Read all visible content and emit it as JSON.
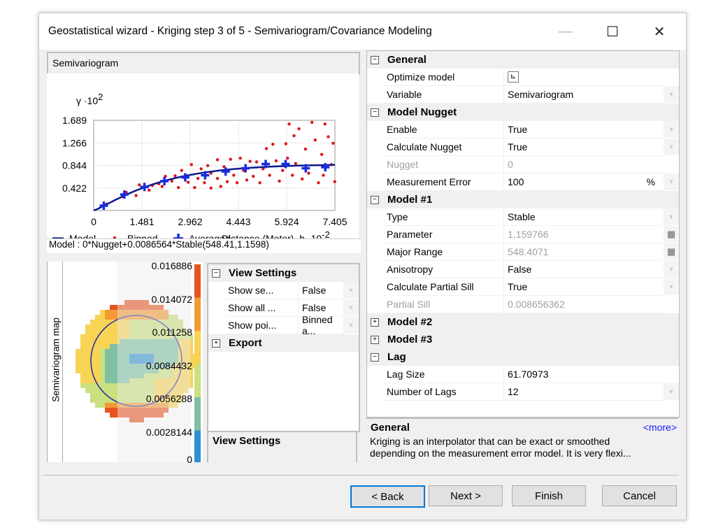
{
  "window": {
    "title": "Geostatistical wizard - Kriging step 3 of 5 - Semivariogram/Covariance Modeling",
    "minimize": "—",
    "maximize": "☐",
    "close": "✕"
  },
  "semivariogram": {
    "panel_title": "Semivariogram",
    "model_text": "Model : 0*Nugget+0.0086564*Stable(548.41,1.1598)",
    "legend": {
      "model": "Model",
      "binned": "Binned",
      "averaged": "Averaged"
    },
    "colors": {
      "model": "#0a1a8c",
      "binned": "#e0141e",
      "averaged": "#1a2be0"
    },
    "chart_data": {
      "type": "scatter",
      "ylabel": "γ ·10",
      "ylabel_exp": "2",
      "xlabel": "Distance (Meter), h ·10",
      "xlabel_exp": "-2",
      "x_ticks": [
        "0",
        "1.481",
        "2.962",
        "4.443",
        "5.924",
        "7.405"
      ],
      "y_ticks": [
        "0.422",
        "0.844",
        "1.266",
        "1.689"
      ],
      "xlim": [
        0,
        7.405
      ],
      "ylim": [
        0,
        1.689
      ],
      "grid": true,
      "legend_placement": "bottom",
      "model": {
        "type": "Stable",
        "nugget": 0,
        "partial_sill": 0.86564,
        "range": 5.4841,
        "parameter": 1.1598
      },
      "averaged": [
        [
          0.31,
          0.09
        ],
        [
          0.94,
          0.3
        ],
        [
          1.56,
          0.44
        ],
        [
          2.17,
          0.55
        ],
        [
          2.81,
          0.62
        ],
        [
          3.42,
          0.66
        ],
        [
          4.05,
          0.73
        ],
        [
          4.66,
          0.79
        ],
        [
          5.28,
          0.87
        ],
        [
          5.89,
          0.87
        ],
        [
          6.51,
          0.79
        ],
        [
          7.11,
          0.81
        ]
      ],
      "binned": [
        [
          0.4,
          0.12
        ],
        [
          0.9,
          0.26
        ],
        [
          1.0,
          0.34
        ],
        [
          1.3,
          0.28
        ],
        [
          1.4,
          0.48
        ],
        [
          1.7,
          0.38
        ],
        [
          1.8,
          0.47
        ],
        [
          2.0,
          0.5
        ],
        [
          2.1,
          0.45
        ],
        [
          2.2,
          0.64
        ],
        [
          2.4,
          0.55
        ],
        [
          2.5,
          0.65
        ],
        [
          2.6,
          0.43
        ],
        [
          2.7,
          0.75
        ],
        [
          2.9,
          0.53
        ],
        [
          3.0,
          0.86
        ],
        [
          3.1,
          0.43
        ],
        [
          3.2,
          0.6
        ],
        [
          3.3,
          0.78
        ],
        [
          3.4,
          0.52
        ],
        [
          3.5,
          0.84
        ],
        [
          3.6,
          0.42
        ],
        [
          3.6,
          0.7
        ],
        [
          3.8,
          0.95
        ],
        [
          3.8,
          0.6
        ],
        [
          3.9,
          0.45
        ],
        [
          4.0,
          0.82
        ],
        [
          4.1,
          0.54
        ],
        [
          4.2,
          0.96
        ],
        [
          4.3,
          0.66
        ],
        [
          4.4,
          0.52
        ],
        [
          4.5,
          0.98
        ],
        [
          4.6,
          0.75
        ],
        [
          4.7,
          0.57
        ],
        [
          4.8,
          0.92
        ],
        [
          4.9,
          0.64
        ],
        [
          5.0,
          0.91
        ],
        [
          5.1,
          0.52
        ],
        [
          5.2,
          0.78
        ],
        [
          5.3,
          1.16
        ],
        [
          5.4,
          0.66
        ],
        [
          5.5,
          1.24
        ],
        [
          5.6,
          0.93
        ],
        [
          5.7,
          0.55
        ],
        [
          5.8,
          0.75
        ],
        [
          5.9,
          1.25
        ],
        [
          5.95,
          0.98
        ],
        [
          6.0,
          1.62
        ],
        [
          6.1,
          0.66
        ],
        [
          6.15,
          1.4
        ],
        [
          6.2,
          0.88
        ],
        [
          6.3,
          1.53
        ],
        [
          6.4,
          0.59
        ],
        [
          6.5,
          1.15
        ],
        [
          6.6,
          0.7
        ],
        [
          6.7,
          1.65
        ],
        [
          6.8,
          1.32
        ],
        [
          6.9,
          0.52
        ],
        [
          7.0,
          1.05
        ],
        [
          7.05,
          0.66
        ],
        [
          7.1,
          1.62
        ],
        [
          7.2,
          1.38
        ],
        [
          7.3,
          0.86
        ],
        [
          7.35,
          1.26
        ],
        [
          7.4,
          0.54
        ]
      ]
    }
  },
  "semivariogram_map": {
    "label": "Semivariogram map",
    "breaks": [
      "0.016886",
      "0.014072",
      "0.011258",
      "0.0084432",
      "0.0056288",
      "0.0028144",
      "0"
    ],
    "colors": [
      "#e8531f",
      "#f39a34",
      "#f7d356",
      "#cbe07e",
      "#7fbfa2",
      "#2e8fd1"
    ],
    "circle_color": "#2a2aa0"
  },
  "view_settings": {
    "group": "View Settings",
    "rows": [
      {
        "name": "Show se...",
        "value": "False"
      },
      {
        "name": "Show all ...",
        "value": "False"
      },
      {
        "name": "Show poi...",
        "value": "Binned a..."
      }
    ],
    "export": "Export",
    "description_title": "View Settings"
  },
  "properties": {
    "general": {
      "label": "General",
      "optimize_model": "Optimize model",
      "variable": "Variable",
      "variable_value": "Semivariogram"
    },
    "nugget": {
      "label": "Model Nugget",
      "enable": "Enable",
      "enable_value": "True",
      "calc": "Calculate Nugget",
      "calc_value": "True",
      "nugget": "Nugget",
      "nugget_value": "0",
      "me": "Measurement Error",
      "me_value": "100",
      "me_unit": "%"
    },
    "model1": {
      "label": "Model #1",
      "type": "Type",
      "type_value": "Stable",
      "param": "Parameter",
      "param_value": "1.159766",
      "range": "Major Range",
      "range_value": "548.4071",
      "aniso": "Anisotropy",
      "aniso_value": "False",
      "cps": "Calculate Partial Sill",
      "cps_value": "True",
      "ps": "Partial Sill",
      "ps_value": "0.008656362"
    },
    "model2": "Model #2",
    "model3": "Model #3",
    "lag": {
      "label": "Lag",
      "size": "Lag Size",
      "size_value": "61.70973",
      "num": "Number of Lags",
      "num_value": "12"
    }
  },
  "description": {
    "title": "General",
    "more": "<more>",
    "text1": "Kriging is an interpolator that can be exact or smoothed",
    "text2": "depending on the measurement error model. It is very flexi..."
  },
  "buttons": {
    "back": "< Back",
    "next": "Next >",
    "finish": "Finish",
    "cancel": "Cancel"
  }
}
